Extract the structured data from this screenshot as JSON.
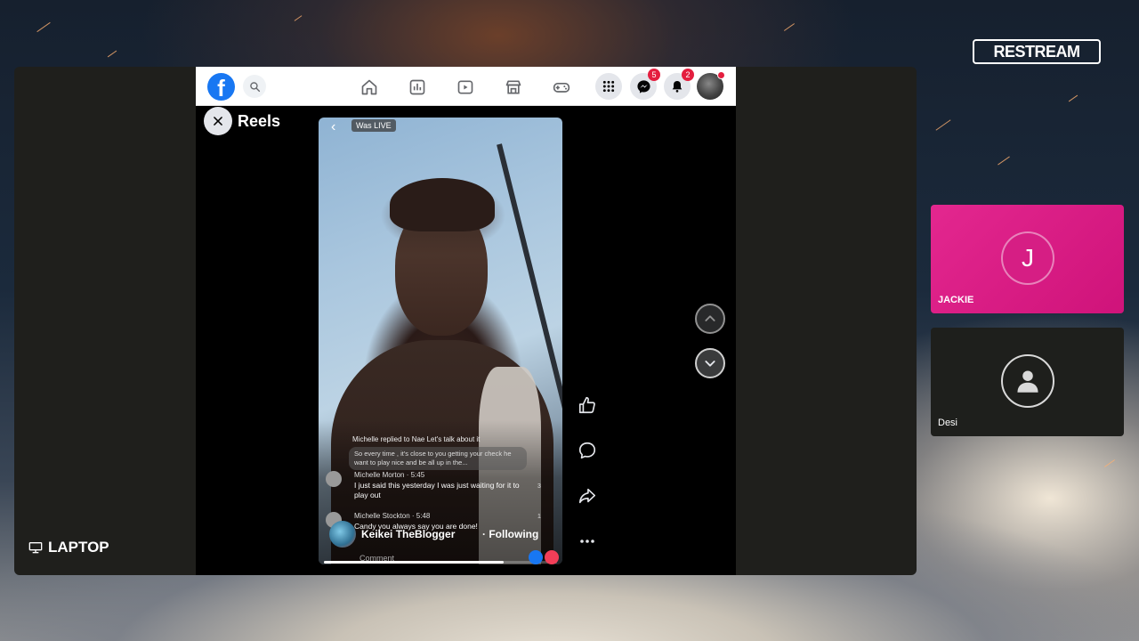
{
  "brand": {
    "restream_label": "RESTREAM"
  },
  "laptop_source": {
    "label": "LAPTOP"
  },
  "facebook": {
    "logo_letter": "f",
    "badges": {
      "messenger": "5",
      "notifications": "2"
    },
    "reels_title": "Reels",
    "reel": {
      "was_live_label": "Was LIVE",
      "reply_notice": "Michelle replied to Nae Let's talk about it",
      "quoted_comment": "So every time , it's close to you getting your check he want to play nice and be all up in the...",
      "comments": [
        {
          "name": "Michelle Morton · 5:45",
          "text": "I just said this yesterday I was just waiting for it to play out",
          "likes": "3"
        },
        {
          "name": "Michelle Stockton · 5:48",
          "text": "Candy you always say you are done!",
          "likes": "1"
        }
      ],
      "author": {
        "name": "Keikei TheBlogger",
        "following": "· Following"
      },
      "comment_placeholder": "Comment",
      "progress_percent": 77
    }
  },
  "guests": [
    {
      "initial": "J",
      "name": "JACKIE",
      "color": "#d61e84"
    },
    {
      "initial": "",
      "name": "Desi",
      "color": "#1e1f1c"
    }
  ],
  "icons": [
    "facebook-logo-icon",
    "search-icon",
    "home-icon",
    "chart-icon",
    "video-icon",
    "marketplace-icon",
    "gaming-icon",
    "menu-grid-icon",
    "messenger-icon",
    "bell-icon",
    "close-icon",
    "chevron-left-icon",
    "like-icon",
    "comment-icon",
    "share-icon",
    "more-icon",
    "chevron-up-icon",
    "chevron-down-icon",
    "monitor-icon",
    "user-icon"
  ]
}
